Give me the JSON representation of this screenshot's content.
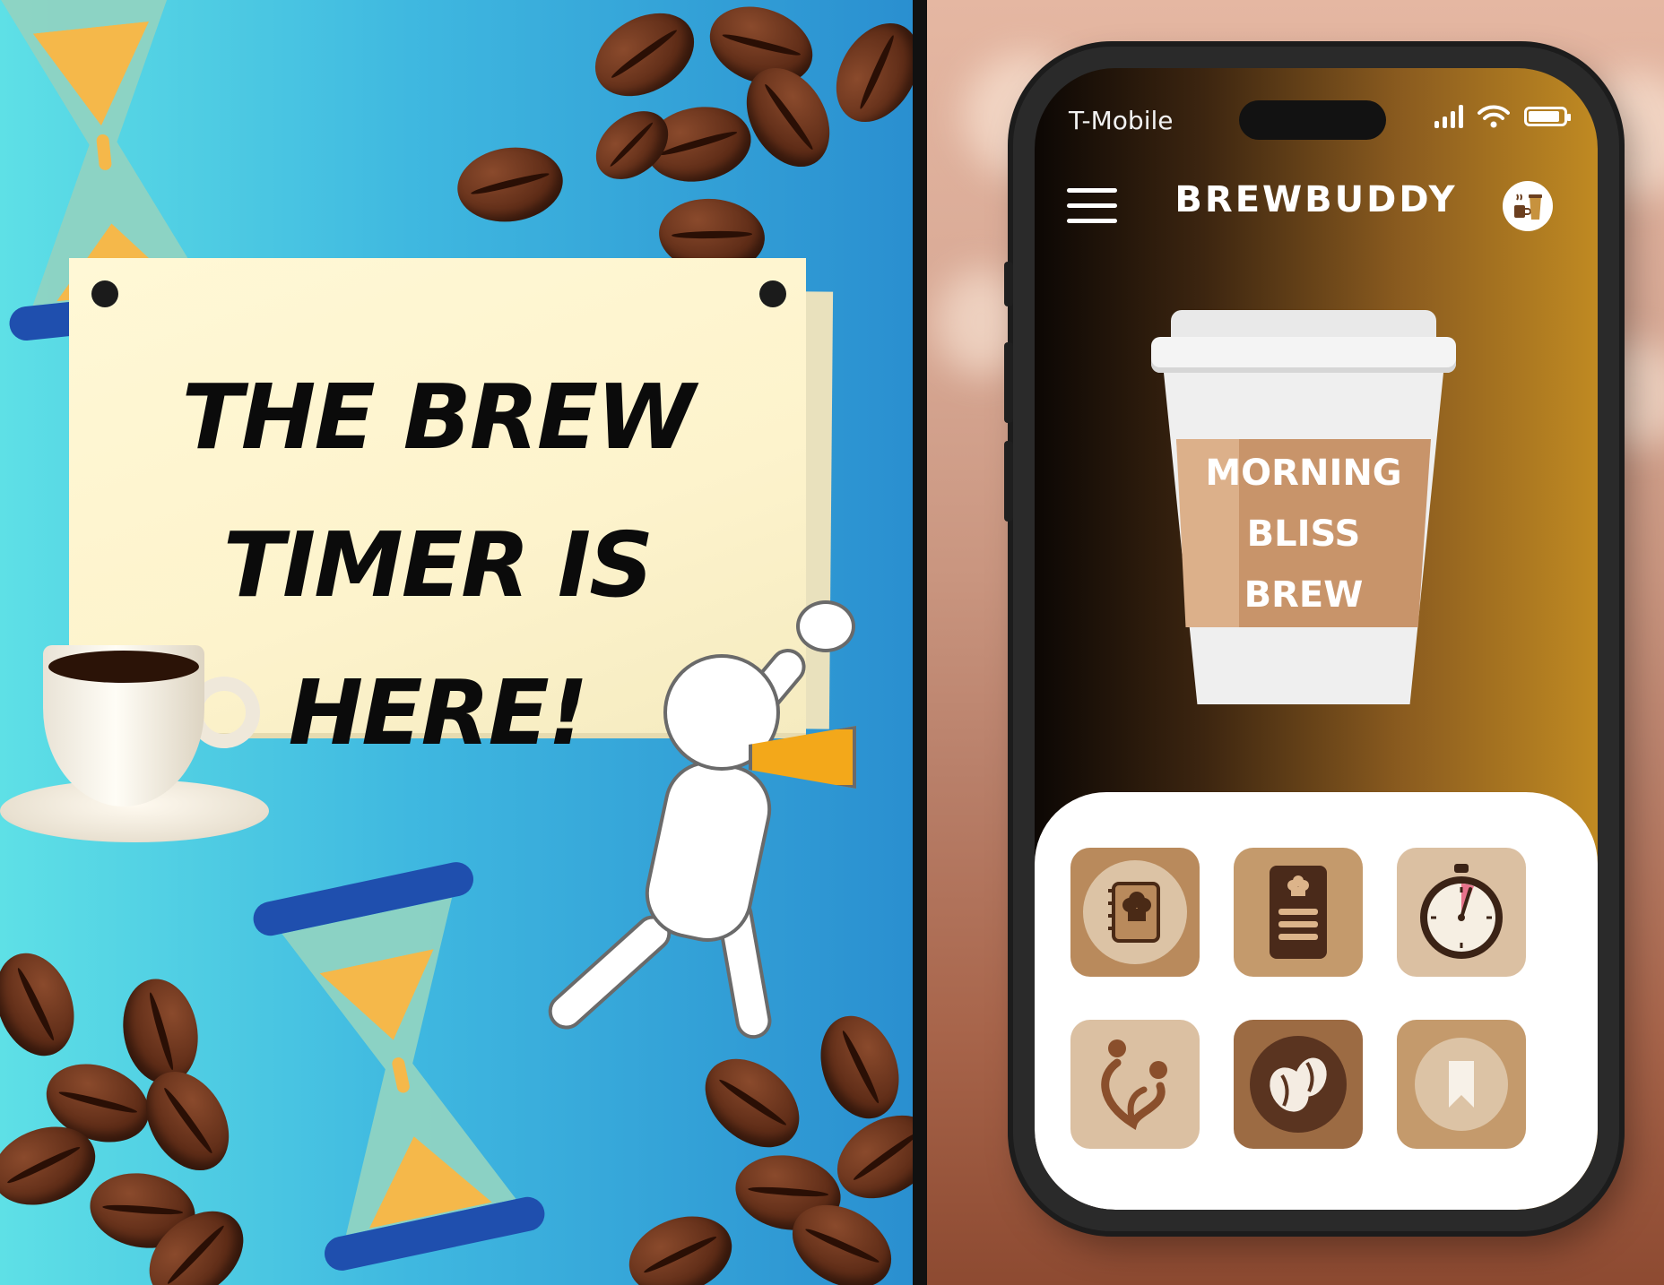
{
  "promo": {
    "headline_line1": "THE BREW",
    "headline_line2": "TIMER IS HERE!"
  },
  "phone": {
    "status_bar": {
      "carrier": "T-Mobile",
      "icons": [
        "cellular-signal-icon",
        "wifi-icon",
        "battery-icon"
      ]
    },
    "app_bar": {
      "title": "BREWBUDDY",
      "left_icon": "hamburger-menu-icon",
      "right_icon": "coffee-cups-profile-icon"
    },
    "featured_brew": {
      "line1": "MORNING",
      "line2": "BLISS",
      "line3": "BREW"
    },
    "menu_tiles": [
      {
        "icon": "recipe-book-icon"
      },
      {
        "icon": "recipe-card-icon"
      },
      {
        "icon": "stopwatch-timer-icon"
      },
      {
        "icon": "community-heart-icon"
      },
      {
        "icon": "coffee-beans-icon"
      },
      {
        "icon": "bookmark-icon"
      }
    ]
  },
  "colors": {
    "left_bg_start": "#5ee0e6",
    "left_bg_end": "#2a8fd0",
    "sign": "#fdf3cc",
    "app_gradient_start": "#0c0704",
    "app_gradient_end": "#c08a22",
    "tile_light": "#dbbfa0",
    "tile_mid": "#c49a6c",
    "tile_dark": "#9c6b43"
  }
}
